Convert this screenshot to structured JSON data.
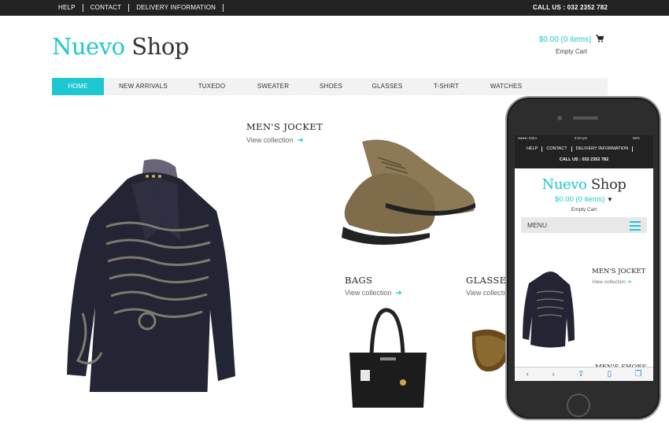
{
  "topbar": {
    "links": [
      "HELP",
      "CONTACT",
      "DELIVERY INFORMATION"
    ],
    "call": "CALL US : 032 2352 782"
  },
  "logo": {
    "part1": "Nuevo",
    "part2": "Shop"
  },
  "cart": {
    "amount": "$0.00 (0 items)",
    "status": "Empty Cart",
    "icon": "cart-icon"
  },
  "nav": {
    "items": [
      "HOME",
      "NEW ARRIVALS",
      "TUXEDO",
      "SWEATER",
      "SHOES",
      "GLASSES",
      "T-SHIRT",
      "WATCHES"
    ],
    "active": "HOME"
  },
  "collections": {
    "jocket": {
      "title": "MEN'S JOCKET",
      "link": "View collection"
    },
    "bags": {
      "title": "BAGS",
      "link": "View collection"
    },
    "glasses": {
      "title": "GLASSES",
      "link": "View collection"
    }
  },
  "mobile": {
    "status": {
      "carrier": "IDEA",
      "time": "9:20 pm",
      "battery": "90%"
    },
    "links": [
      "HELP",
      "CONTACT",
      "DELIVERY INFORMATION"
    ],
    "call": "CALL US : 032 2352 782",
    "logo": {
      "part1": "Nuevo",
      "part2": "Shop"
    },
    "cart": "$0.00 (0 items)",
    "empty": "Empty Cart",
    "menu": "MENU",
    "jocket": {
      "title": "MEN'S JOCKET",
      "link": "View collection"
    },
    "shoes_title": "MEN'S SHOES"
  },
  "colors": {
    "accent": "#1ec8d2",
    "topbar": "#222222"
  }
}
